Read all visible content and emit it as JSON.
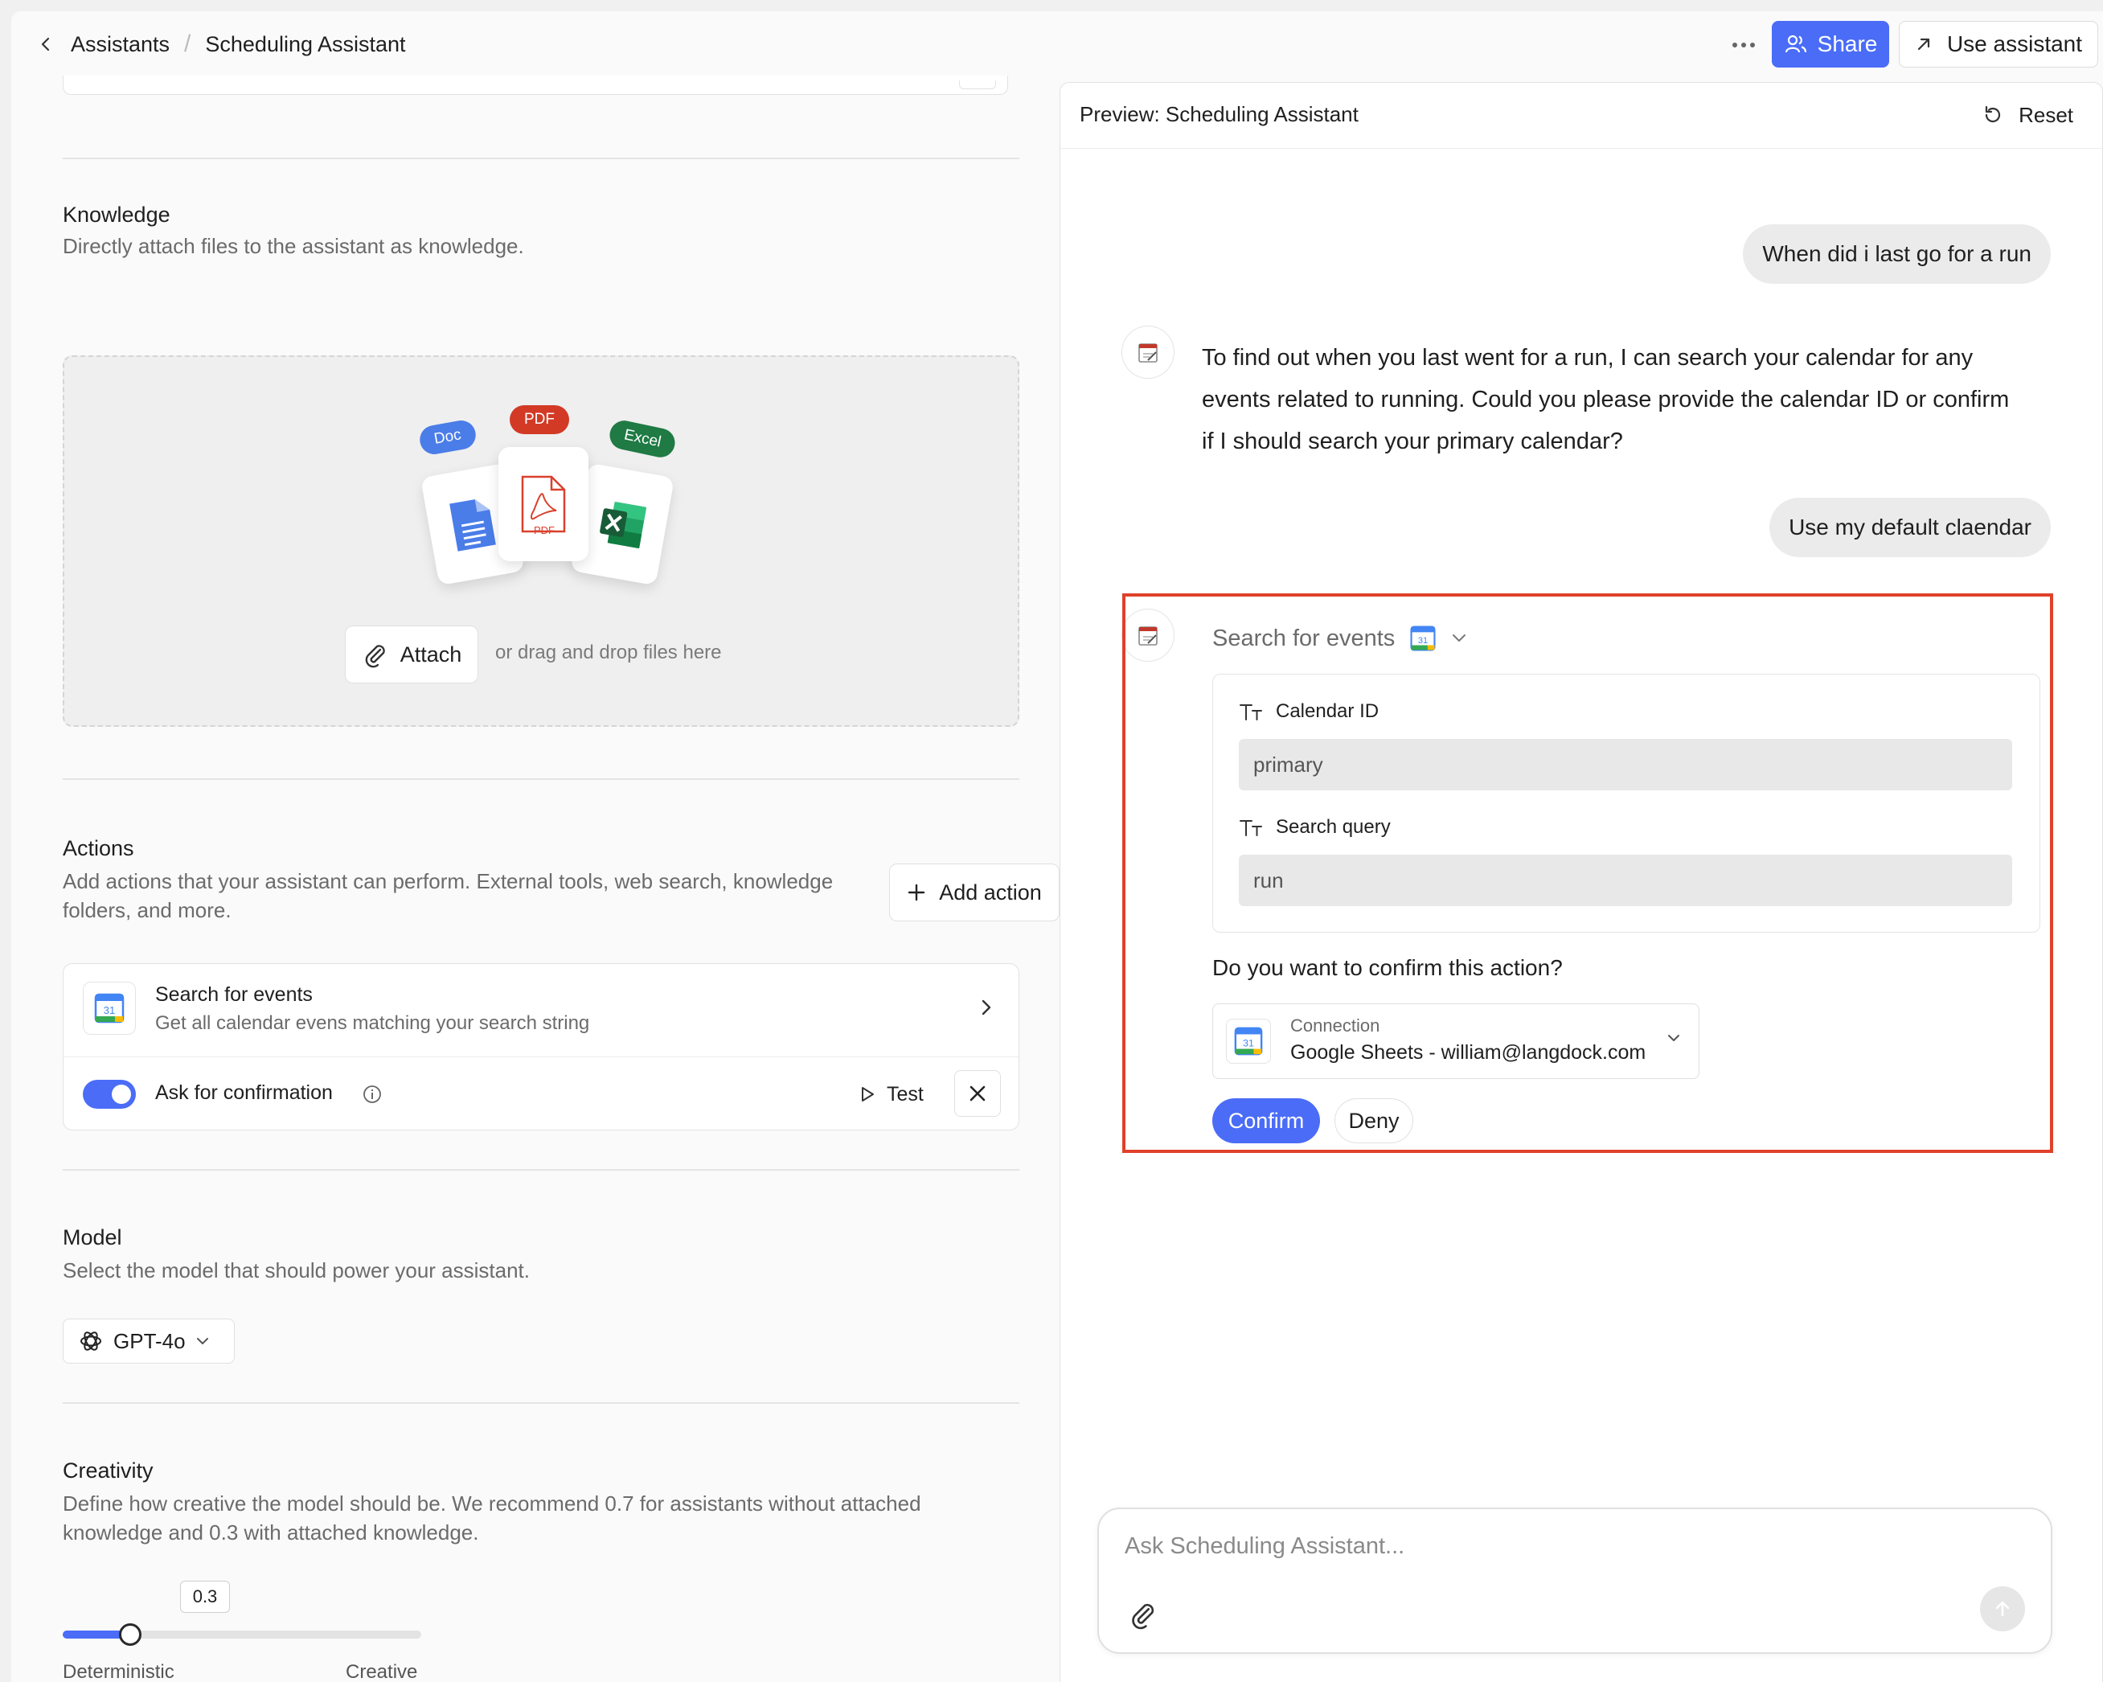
{
  "breadcrumb": {
    "parent": "Assistants",
    "separator": "/",
    "current": "Scheduling Assistant"
  },
  "header": {
    "share_label": "Share",
    "use_label": "Use assistant"
  },
  "knowledge": {
    "title": "Knowledge",
    "description": "Directly attach files to the assistant as knowledge.",
    "pill_doc": "Doc",
    "pill_pdf": "PDF",
    "pill_excel": "Excel",
    "pdf_card_text": "PDF",
    "attach_label": "Attach",
    "drag_text": "or drag and drop files here"
  },
  "actions": {
    "title": "Actions",
    "description": "Add actions that your assistant can perform. External tools, web search, knowledge folders, and more.",
    "add_label": "Add action",
    "item": {
      "name": "Search for events",
      "description": "Get all calendar evens matching your search string",
      "calendar_day": "31"
    },
    "confirm_label": "Ask for confirmation",
    "confirm_enabled": true,
    "test_label": "Test"
  },
  "model": {
    "title": "Model",
    "description": "Select the model that should power your assistant.",
    "selected": "GPT-4o"
  },
  "creativity": {
    "title": "Creativity",
    "description": "Define how creative the model should be. We recommend 0.7 for assistants without attached knowledge and 0.3 with attached knowledge.",
    "value": "0.3",
    "min_label": "Deterministic",
    "max_label": "Creative",
    "fill_fraction": 0.3
  },
  "preview": {
    "title": "Preview: Scheduling Assistant",
    "reset_label": "Reset",
    "messages": {
      "user1": "When did i last go for a run",
      "assistant1": "To find out when you last went for a run, I can search your calendar for any events related to running. Could you please provide the calendar ID or confirm if I should search your primary calendar?",
      "user2": "Use my default claendar"
    },
    "tool": {
      "name": "Search for events",
      "calendar_day": "31",
      "param1_label": "Calendar ID",
      "param1_value": "primary",
      "param2_label": "Search query",
      "param2_value": "run",
      "question": "Do you want to confirm this action?",
      "connection_label": "Connection",
      "connection_value": "Google Sheets - william@langdock.com",
      "confirm_label": "Confirm",
      "deny_label": "Deny"
    },
    "composer_placeholder": "Ask Scheduling Assistant..."
  },
  "colors": {
    "accent": "#4a6cf7",
    "highlight": "#e0412a"
  }
}
